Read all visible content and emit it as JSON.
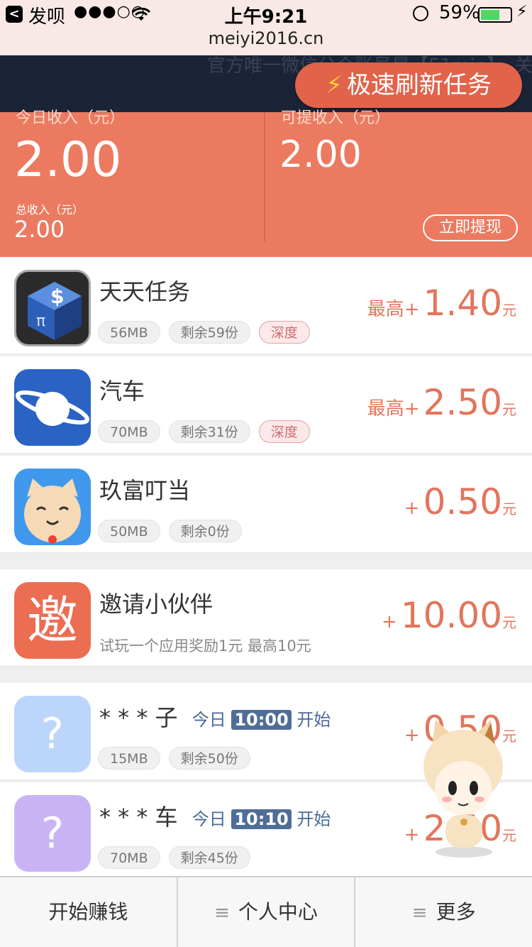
{
  "status": {
    "carrier": "发呗",
    "signal": "●●●○○",
    "time": "上午9:21",
    "battery": "59%"
  },
  "url": "meiyi2016.cn",
  "notice": "官方唯一微信公众账号是【51min】，关",
  "refresh_button": "极速刷新任务",
  "income": {
    "today_label": "今日收入（元）",
    "today_value": "2.00",
    "total_label": "总收入（元）",
    "total_value": "2.00",
    "available_label": "可提收入（元）",
    "available_value": "2.00",
    "withdraw_label": "立即提现"
  },
  "tasks": [
    {
      "name": "天天任务",
      "size": "56MB",
      "remaining": "剩余59份",
      "badge": "深度",
      "prefix": "最高+",
      "amount": "1.40",
      "unit": "元"
    },
    {
      "name": "汽车",
      "size": "70MB",
      "remaining": "剩余31份",
      "badge": "深度",
      "prefix": "最高+",
      "amount": "2.50",
      "unit": "元"
    },
    {
      "name": "玖富叮当",
      "size": "50MB",
      "remaining": "剩余0份",
      "prefix": "+",
      "amount": "0.50",
      "unit": "元"
    }
  ],
  "invite": {
    "icon_text": "邀",
    "title": "邀请小伙伴",
    "subtitle": "试玩一个应用奖励1元 最高10元",
    "prefix": "+",
    "amount": "10.00",
    "unit": "元"
  },
  "upcoming": [
    {
      "name": "* * * 子",
      "day": "今日",
      "time": "10:00",
      "action": "开始",
      "size": "15MB",
      "remaining": "剩余50份",
      "prefix": "+",
      "amount": "0.50",
      "unit": "元",
      "icon_color": "#bcd6fb"
    },
    {
      "name": "* * * 车",
      "day": "今日",
      "time": "10:10",
      "action": "开始",
      "size": "70MB",
      "remaining": "剩余45份",
      "prefix": "+",
      "amount": "2.50",
      "unit": "元",
      "icon_color": "#c8b4f5"
    }
  ],
  "tabbar": {
    "tab1": "开始赚钱",
    "tab2": "个人中心",
    "tab3": "更多"
  },
  "colors": {
    "accent": "#eb7a60",
    "reward": "#e2755c",
    "notice_bg": "#1b2336"
  }
}
